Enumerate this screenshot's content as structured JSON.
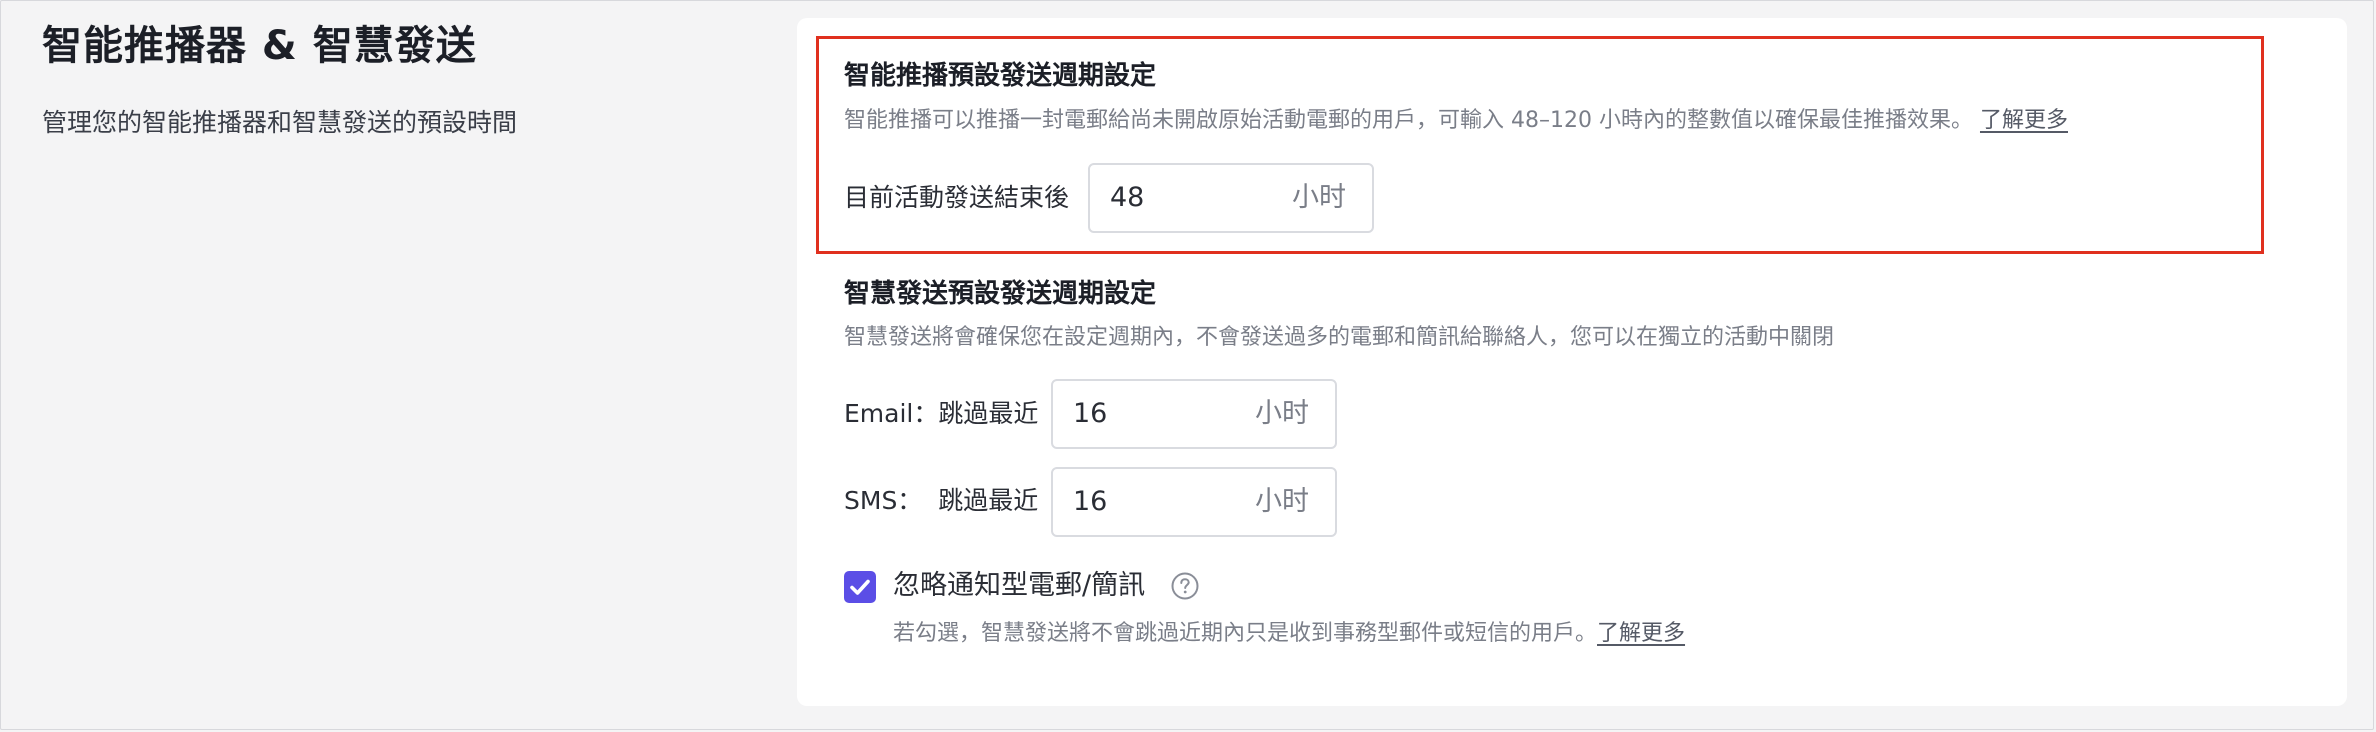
{
  "page": {
    "title": "智能推播器 & 智慧發送",
    "description": "管理您的智能推播器和智慧發送的預設時間"
  },
  "smart_resend": {
    "title": "智能推播預設發送週期設定",
    "description": "智能推播可以推播一封電郵給尚未開啟原始活動電郵的用戶，可輸入 48–120 小時內的整數值以確保最佳推播效果。",
    "learn_more": "了解更多",
    "field_label": "目前活動發送結束後",
    "value": "48",
    "unit": "小时"
  },
  "smart_sending": {
    "title": "智慧發送預設發送週期設定",
    "description": "智慧發送將會確保您在設定週期內，不會發送過多的電郵和簡訊給聯絡人，您可以在獨立的活動中關閉",
    "email_label": "Email：跳過最近",
    "email_value": "16",
    "email_unit": "小时",
    "sms_label": "SMS：  跳過最近",
    "sms_value": "16",
    "sms_unit": "小时",
    "ignore_checkbox_label": "忽略通知型電郵/簡訊",
    "ignore_checked": true,
    "ignore_description": "若勾選，智慧發送將不會跳過近期內只是收到事務型郵件或短信的用戶。",
    "learn_more": "了解更多"
  },
  "colors": {
    "accent": "#5b4ee6",
    "highlight_border": "#e0301e"
  },
  "icons": {
    "checkbox": "check-icon",
    "help": "question-circle-icon"
  }
}
